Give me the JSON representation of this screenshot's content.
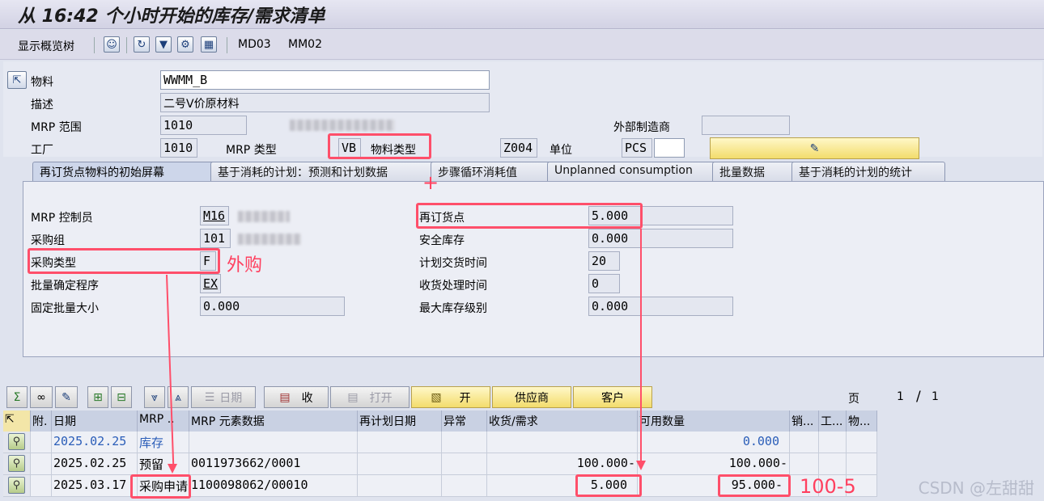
{
  "title": "从 16:42 个小时开始的库存/需求清单",
  "toolbar": {
    "overview_tree": "显示概览树",
    "md03": "MD03",
    "mm02": "MM02"
  },
  "header": {
    "material_label": "物料",
    "material_value": "WWMM_B",
    "desc_label": "描述",
    "desc_value": "二号V价原材料",
    "mrp_area_label": "MRP 范围",
    "mrp_area_value": "1010",
    "ext_mfr_label": "外部制造商",
    "plant_label": "工厂",
    "plant_value": "1010",
    "mrp_type_label": "MRP 类型",
    "mrp_type_value": "VB",
    "material_type_label": "物料类型",
    "material_type_value": "Z004",
    "unit_label": "单位",
    "unit_value": "PCS"
  },
  "tabs": [
    "再订货点物料的初始屏幕",
    "基于消耗的计划：预测和计划数据",
    "步骤循环消耗值",
    "Unplanned consumption",
    "批量数据",
    "基于消耗的计划的统计"
  ],
  "detail": {
    "mrp_controller_label": "MRP 控制员",
    "mrp_controller_value": "M16",
    "purch_group_label": "采购组",
    "purch_group_value": "101",
    "proc_type_label": "采购类型",
    "proc_type_value": "F",
    "lot_size_label": "批量确定程序",
    "lot_size_value": "EX",
    "fixed_lot_label": "固定批量大小",
    "fixed_lot_value": "0.000",
    "reorder_label": "再订货点",
    "reorder_value": "5.000",
    "safety_label": "安全库存",
    "safety_value": "0.000",
    "planned_delivery_label": "计划交货时间",
    "planned_delivery_value": "20",
    "gr_time_label": "收货处理时间",
    "gr_time_value": "0",
    "max_stock_label": "最大库存级别",
    "max_stock_value": "0.000"
  },
  "grid_toolbar": {
    "date": "日期",
    "receipt": "收",
    "open": "打开",
    "open2": "开",
    "vendor": "供应商",
    "customer": "客户",
    "page_label": "页",
    "page_current": "1",
    "page_sep": "/",
    "page_total": "1"
  },
  "grid": {
    "columns": [
      "附.",
      "日期",
      "MRP ..",
      "MRP 元素数据",
      "再计划日期",
      "异常",
      "收货/需求",
      "可用数量",
      "销...",
      "工...",
      "物..."
    ],
    "rows": [
      {
        "date": "2025.02.25",
        "element": "库存",
        "data": "",
        "reschedule": "",
        "exception": "",
        "receipt": "",
        "available": "0.000"
      },
      {
        "date": "2025.02.25",
        "element": "预留",
        "data": "0011973662/0001",
        "reschedule": "",
        "exception": "",
        "receipt": "100.000-",
        "available": "100.000-"
      },
      {
        "date": "2025.03.17",
        "element": "采购申请",
        "data": "1100098062/00010",
        "reschedule": "",
        "exception": "",
        "receipt": "5.000",
        "available": "95.000-"
      }
    ]
  },
  "annotations": {
    "external": "外购",
    "calc": "100-5",
    "plus": "+"
  },
  "watermark": "CSDN @左甜甜",
  "colors": {
    "annotation": "#ff4f6a",
    "active_tab": "#cdd6ea"
  }
}
